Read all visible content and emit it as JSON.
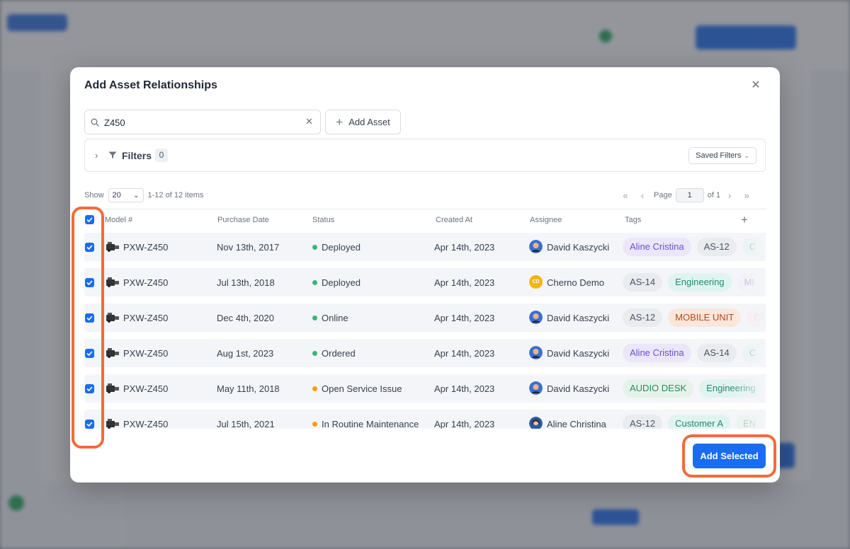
{
  "modal": {
    "title": "Add Asset Relationships",
    "close_icon": "close-icon",
    "search": {
      "value": "Z450",
      "clear_icon": "clear-icon",
      "icon": "search-icon"
    },
    "add_asset_label": "Add Asset",
    "filters": {
      "label": "Filters",
      "count": "0",
      "saved_filters_label": "Saved Filters"
    },
    "pagination": {
      "show_label": "Show",
      "page_size": "20",
      "range_text": "1-12 of 12 items",
      "page_label": "Page",
      "page_value": "1",
      "of_text": "of 1"
    },
    "columns": [
      "Model #",
      "Purchase Date",
      "Status",
      "Created At",
      "Assignee",
      "Tags"
    ],
    "rows": [
      {
        "model": "PXW-Z450",
        "purchase_date": "Nov 13th, 2017",
        "status": "Deployed",
        "created_at": "Apr 14th, 2023",
        "assignee": "David Kaszycki",
        "tags": [
          "Aline Cristina",
          "AS-12",
          "C"
        ]
      },
      {
        "model": "PXW-Z450",
        "purchase_date": "Jul 13th, 2018",
        "status": "Deployed",
        "created_at": "Apr 14th, 2023",
        "assignee": "Cherno Demo",
        "avatar_initials": "CD",
        "tags": [
          "AS-14",
          "Engineering",
          "MI"
        ]
      },
      {
        "model": "PXW-Z450",
        "purchase_date": "Dec 4th, 2020",
        "status": "Online",
        "created_at": "Apr 14th, 2023",
        "assignee": "David Kaszycki",
        "tags": [
          "AS-12",
          "MOBILE UNIT",
          "OE"
        ]
      },
      {
        "model": "PXW-Z450",
        "purchase_date": "Aug 1st, 2023",
        "status": "Ordered",
        "created_at": "Apr 14th, 2023",
        "assignee": "David Kaszycki",
        "tags": [
          "Aline Cristina",
          "AS-14",
          "C"
        ]
      },
      {
        "model": "PXW-Z450",
        "purchase_date": "May 11th, 2018",
        "status": "Open Service Issue",
        "created_at": "Apr 14th, 2023",
        "assignee": "David Kaszycki",
        "tags": [
          "AUDIO DESK",
          "Engineering"
        ]
      },
      {
        "model": "PXW-Z450",
        "purchase_date": "Jul 15th, 2021",
        "status": "In Routine Maintenance",
        "created_at": "Apr 14th, 2023",
        "assignee": "Aline Christina",
        "tags": [
          "AS-12",
          "Customer A",
          "EN"
        ]
      }
    ],
    "add_selected_label": "Add Selected"
  },
  "colors": {
    "primary": "#1a6cf2",
    "status_green": "#3bb575",
    "status_orange": "#f59e0b",
    "annotation": "#f26b3a"
  }
}
